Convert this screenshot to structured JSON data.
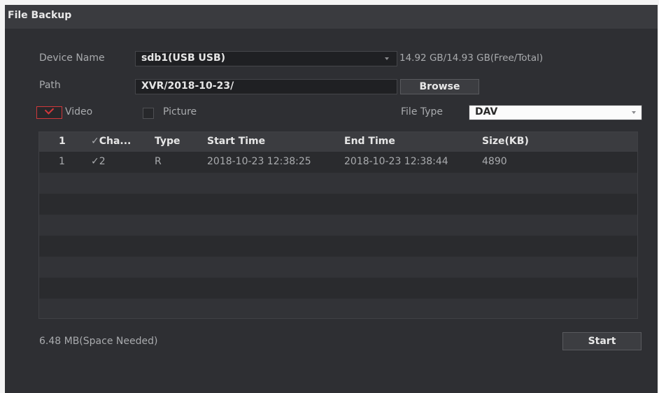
{
  "window": {
    "title": "File Backup"
  },
  "form": {
    "device_name_label": "Device Name",
    "device_name_value": "sdb1(USB USB)",
    "capacity": "14.92 GB/14.93 GB(Free/Total)",
    "path_label": "Path",
    "path_value": "XVR/2018-10-23/",
    "browse_label": "Browse",
    "video_label": "Video",
    "video_checked": true,
    "picture_label": "Picture",
    "picture_checked": false,
    "file_type_label": "File Type",
    "file_type_value": "DAV"
  },
  "table": {
    "headers": {
      "index": "1",
      "channel": "Cha...",
      "type": "Type",
      "start_time": "Start Time",
      "end_time": "End Time",
      "size": "Size(KB)"
    },
    "rows": [
      {
        "index": "1",
        "channel": "2",
        "type": "R",
        "start_time": "2018-10-23 12:38:25",
        "end_time": "2018-10-23 12:38:44",
        "size": "4890"
      }
    ]
  },
  "footer": {
    "space_needed": "6.48 MB(Space Needed)",
    "start_label": "Start"
  },
  "colors": {
    "accent": "#d0383b",
    "background": "#2e2f33",
    "titlebar": "#3a3b3f"
  }
}
